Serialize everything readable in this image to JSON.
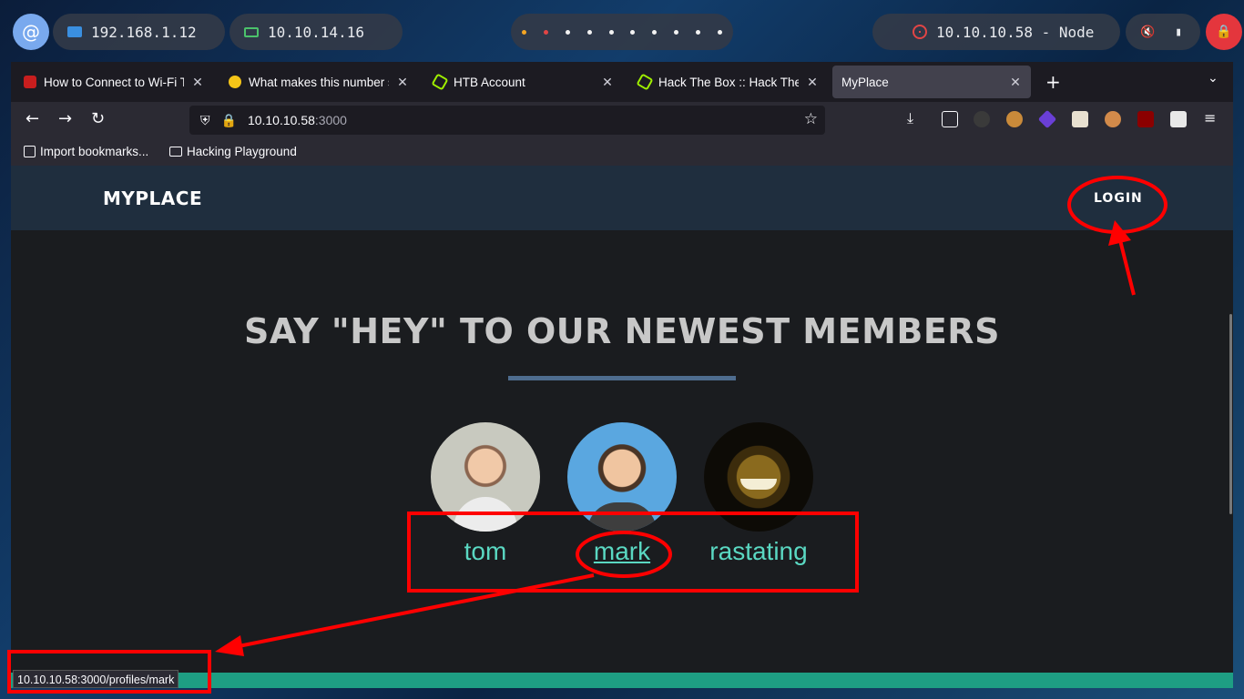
{
  "desktop": {
    "lan_ip": "192.168.1.12",
    "vpn_ip": "10.10.14.16",
    "target": "10.10.10.58 - Node",
    "os_logo_icon": "debian-swirl-icon",
    "volume_icon": "volume-muted-icon",
    "battery_icon": "battery-icon",
    "lock_icon": "lock-icon"
  },
  "browser": {
    "tabs": [
      {
        "label": "How to Connect to Wi-Fi Th",
        "favicon": "red"
      },
      {
        "label": "What makes this number s",
        "favicon": "yellow"
      },
      {
        "label": "HTB Account",
        "favicon": "green"
      },
      {
        "label": "Hack The Box :: Hack The E",
        "favicon": "green"
      },
      {
        "label": "MyPlace",
        "favicon": "none"
      }
    ],
    "url_host": "10.10.10.58",
    "url_port": ":3000",
    "bookmarks": [
      "Import bookmarks...",
      "Hacking Playground"
    ],
    "status_url": "10.10.10.58:3000/profiles/mark"
  },
  "site": {
    "brand": "MYPLACE",
    "login": "LOGIN",
    "headline": "SAY \"HEY\" TO OUR NEWEST MEMBERS",
    "members": [
      {
        "name": "tom"
      },
      {
        "name": "mark"
      },
      {
        "name": "rastating"
      }
    ]
  },
  "colors": {
    "accent_link": "#5ad8c2",
    "annotation": "#ff0000",
    "nav_bg": "#1f2e3e",
    "footer": "#1e9e83"
  }
}
